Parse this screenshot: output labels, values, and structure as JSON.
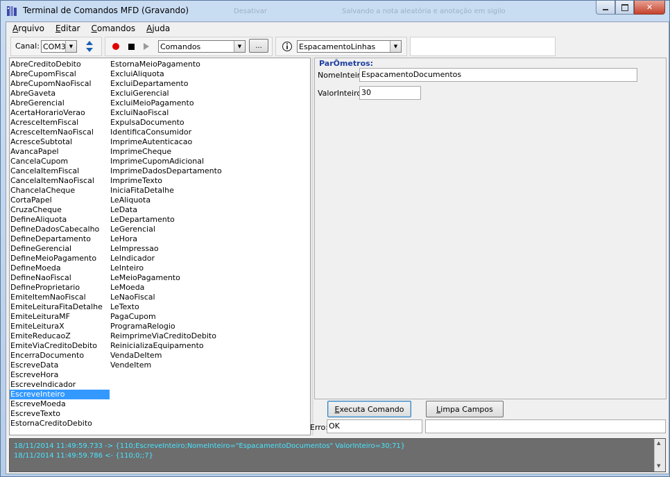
{
  "window": {
    "title": "Terminal de Comandos MFD (Gravando)",
    "bg_text_1": "Desativar",
    "bg_text_2": "Salvando a nota aleatória e anotação em sigilo"
  },
  "menu": [
    {
      "label": "Arquivo",
      "key": "A",
      "rest": "rquivo"
    },
    {
      "label": "Editar",
      "key": "E",
      "rest": "ditar"
    },
    {
      "label": "Comandos",
      "key": "C",
      "rest": "omandos"
    },
    {
      "label": "Ajuda",
      "key": "A",
      "rest": "juda"
    }
  ],
  "toolbar": {
    "canal_label": "Canal:",
    "canal_value": "COM3",
    "commands_value": "Comandos",
    "more_button": "...",
    "filter_value": "EspacamentoLinhas",
    "record_icon": "record-icon",
    "stop_icon": "stop-icon",
    "play_icon": "play-icon",
    "info_icon": "info-icon",
    "swap_icon": "swap-icon",
    "record_color": "#e00000"
  },
  "commands": {
    "column1": [
      "AbreCreditoDebito",
      "AbreCupomFiscal",
      "AbreCupomNaoFiscal",
      "AbreGaveta",
      "AbreGerencial",
      "AcertaHorarioVerao",
      "AcresceItemFiscal",
      "AcresceItemNaoFiscal",
      "AcresceSubtotal",
      "AvancaPapel",
      "CancelaCupom",
      "CancelaItemFiscal",
      "CancelaItemNaoFiscal",
      "ChancelaCheque",
      "CortaPapel",
      "CruzaCheque",
      "DefineAliquota",
      "DefineDadosCabecalho",
      "DefineDepartamento",
      "DefineGerencial",
      "DefineMeioPagamento",
      "DefineMoeda",
      "DefineNaoFiscal",
      "DefineProprietario",
      "EmiteItemNaoFiscal",
      "EmiteLeituraFitaDetalhe",
      "EmiteLeituraMF",
      "EmiteLeituraX",
      "EmiteReducaoZ",
      "EmiteViaCreditoDebito",
      "EncerraDocumento",
      "EscreveData",
      "EscreveHora",
      "EscreveIndicador",
      "EscreveInteiro",
      "EscreveMoeda",
      "EscreveTexto",
      "EstornaCreditoDebito"
    ],
    "column2": [
      "EstornaMeioPagamento",
      "ExcluiAliquota",
      "ExcluiDepartamento",
      "ExcluiGerencial",
      "ExcluiMeioPagamento",
      "ExcluiNaoFiscal",
      "ExpulsaDocumento",
      "IdentificaConsumidor",
      "ImprimeAutenticacao",
      "ImprimeCheque",
      "ImprimeCupomAdicional",
      "ImprimeDadosDepartamento",
      "ImprimeTexto",
      "IniciaFitaDetalhe",
      "LeAliquota",
      "LeData",
      "LeDepartamento",
      "LeGerencial",
      "LeHora",
      "LeImpressao",
      "LeIndicador",
      "LeInteiro",
      "LeMeioPagamento",
      "LeMoeda",
      "LeNaoFiscal",
      "LeTexto",
      "PagaCupom",
      "ProgramaRelogio",
      "ReimprimeViaCreditoDebito",
      "ReinicializaEquipamento",
      "VendaDeItem",
      "VendeItem"
    ],
    "selected": "EscreveInteiro",
    "selected_color": "#3399ff"
  },
  "params": {
    "title": "ParÔmetros:",
    "title_color": "#1f3fa0",
    "fields": [
      {
        "label": "NomeInteiro:",
        "value": "EspacamentoDocumentos"
      },
      {
        "label": "ValorInteiro:",
        "value": "30"
      }
    ]
  },
  "actions": {
    "execute_label": "Executa Comando",
    "execute_key": "E",
    "execute_rest": "xecuta Comando",
    "clear_label": "Limpa Campos",
    "clear_key": "L",
    "clear_rest": "impa Campos"
  },
  "error": {
    "label": "Erro:",
    "value": "OK",
    "extra": ""
  },
  "log": {
    "lines": [
      "18/11/2014 11:49:59.733 -> {110;EscreveInteiro;NomeInteiro=\"EspacamentoDocumentos\" ValorInteiro=30;71}",
      "18/11/2014 11:49:59.786 <- {110;0;;7}"
    ],
    "text_color": "#47e6ff"
  }
}
